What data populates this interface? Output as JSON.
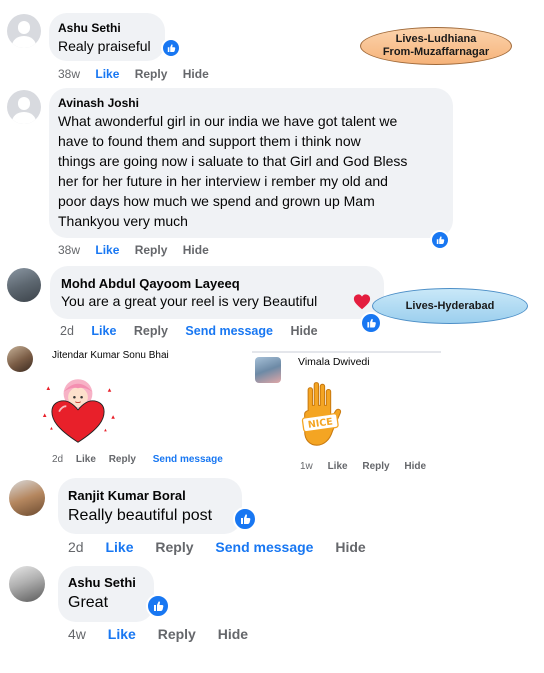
{
  "comments": [
    {
      "author": "Ashu Sethi",
      "text": "Realy praiseful",
      "time": "38w",
      "like": "Like",
      "reply": "Reply",
      "hide": "Hide"
    },
    {
      "author": "Avinash Joshi",
      "lines": [
        "What awonderful girl in our india we have got talent we",
        "have to found them and support them i think now",
        "things are going now i saluate to that Girl and God Bless",
        "her for her future in her interview i rember my old and",
        "poor days how much we spend and grown up Mam",
        "Thankyou very much"
      ],
      "time": "38w",
      "like": "Like",
      "reply": "Reply",
      "hide": "Hide"
    },
    {
      "author": "Mohd Abdul Qayoom Layeeq",
      "text": "You are a great your reel is very Beautiful",
      "time": "2d",
      "like": "Like",
      "reply": "Reply",
      "send": "Send message",
      "hide": "Hide"
    },
    {
      "author": "Jitendar Kumar Sonu Bhai",
      "time": "2d",
      "like": "Like",
      "reply": "Reply",
      "send": "Send message"
    },
    {
      "author": "Vimala Dwivedi",
      "sticker_text": "NICE",
      "time": "1w",
      "like": "Like",
      "reply": "Reply",
      "hide": "Hide"
    },
    {
      "author": "Ranjit Kumar Boral",
      "text": "Really beautiful post",
      "time": "2d",
      "like": "Like",
      "reply": "Reply",
      "send": "Send message",
      "hide": "Hide"
    },
    {
      "author": "Ashu Sethi",
      "text": "Great",
      "time": "4w",
      "like": "Like",
      "reply": "Reply",
      "hide": "Hide"
    }
  ],
  "annotations": {
    "ludhiana": [
      "Lives-Ludhiana",
      "From-Muzaffarnagar"
    ],
    "hyderabad": "Lives-Hyderabad"
  },
  "colors": {
    "link_blue": "#1877f2",
    "bubble": "#f0f2f5",
    "meta_gray": "#65676b"
  },
  "icons": [
    "like-reaction-icon",
    "heart-reaction-icon",
    "default-avatar-icon"
  ]
}
